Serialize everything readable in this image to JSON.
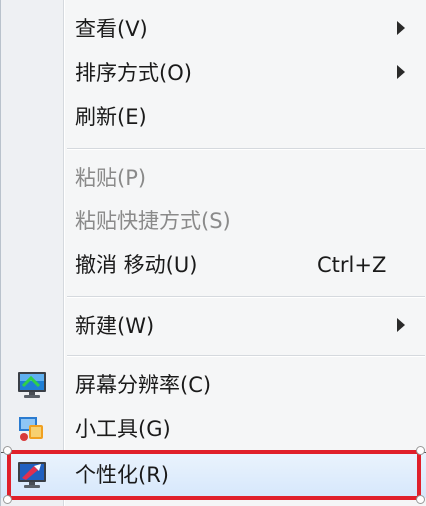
{
  "menu": {
    "items": [
      {
        "label": "查看(V)",
        "submenu": true
      },
      {
        "label": "排序方式(O)",
        "submenu": true
      },
      {
        "label": "刷新(E)"
      },
      {
        "label": "粘贴(P)",
        "disabled": true
      },
      {
        "label": "粘贴快捷方式(S)",
        "disabled": true
      },
      {
        "label": "撤消 移动(U)",
        "shortcut": "Ctrl+Z"
      },
      {
        "label": "新建(W)",
        "submenu": true
      },
      {
        "label": "屏幕分辨率(C)",
        "icon": "monitor-icon"
      },
      {
        "label": "小工具(G)",
        "icon": "gadgets-icon"
      },
      {
        "label": "个性化(R)",
        "icon": "personalize-icon",
        "highlighted": true
      }
    ]
  },
  "colors": {
    "highlight_border": "#e0202b",
    "disabled_text": "#8a8a8a"
  }
}
